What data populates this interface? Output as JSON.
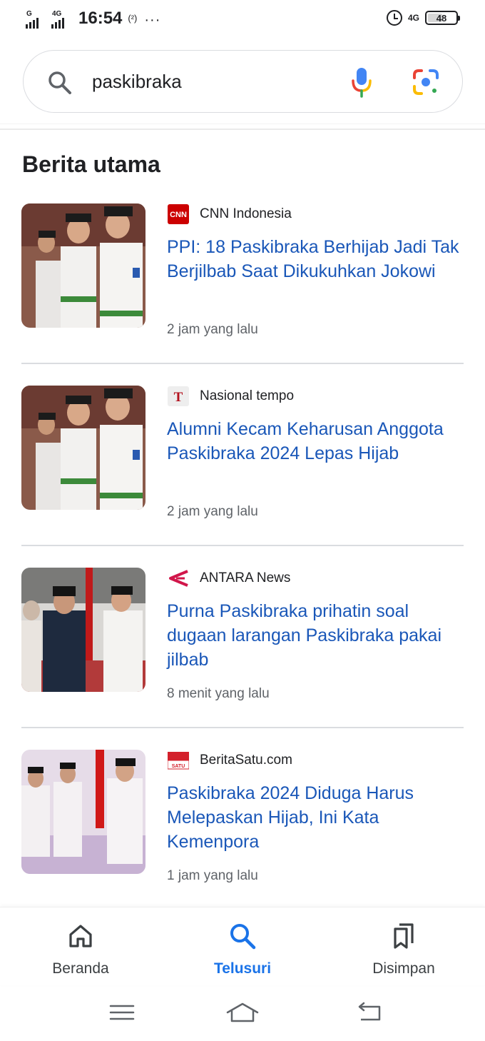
{
  "status_bar": {
    "sim1_tag": "G",
    "sim2_tag": "4G",
    "time": "16:54",
    "hotspot_label": "(²)",
    "more_dots": "···",
    "network_right": "4G",
    "battery": "48"
  },
  "search": {
    "query": "paskibraka",
    "icons": [
      "search-icon",
      "mic-icon",
      "google-lens-icon"
    ]
  },
  "section_title": "Berita utama",
  "news": [
    {
      "source": "CNN Indonesia",
      "logo": "cnn-logo",
      "headline": "PPI: 18 Paskibraka Berhijab Jadi Tak Berjilbab Saat Dikukuhkan Jokowi",
      "time": "2 jam yang lalu"
    },
    {
      "source": "Nasional tempo",
      "logo": "tempo-logo",
      "headline": "Alumni Kecam Keharusan Anggota Paskibraka 2024 Lepas Hijab",
      "time": "2 jam yang lalu"
    },
    {
      "source": "ANTARA News",
      "logo": "antara-logo",
      "headline": "Purna Paskibraka prihatin soal dugaan larangan Paskibraka pakai jilbab",
      "time": "8 menit yang lalu"
    },
    {
      "source": "BeritaSatu.com",
      "logo": "beritasatu-logo",
      "headline": "Paskibraka 2024 Diduga Harus Melepaskan Hijab, Ini Kata Kemenpora",
      "time": "1 jam yang lalu"
    }
  ],
  "bottom_nav": {
    "home": "Beranda",
    "search": "Telusuri",
    "saved": "Disimpan",
    "active": "search"
  },
  "colors": {
    "link_blue": "#1a57b8",
    "active_blue": "#1a73e8",
    "cnn_red": "#cc0000",
    "antara_red": "#d1164a"
  }
}
